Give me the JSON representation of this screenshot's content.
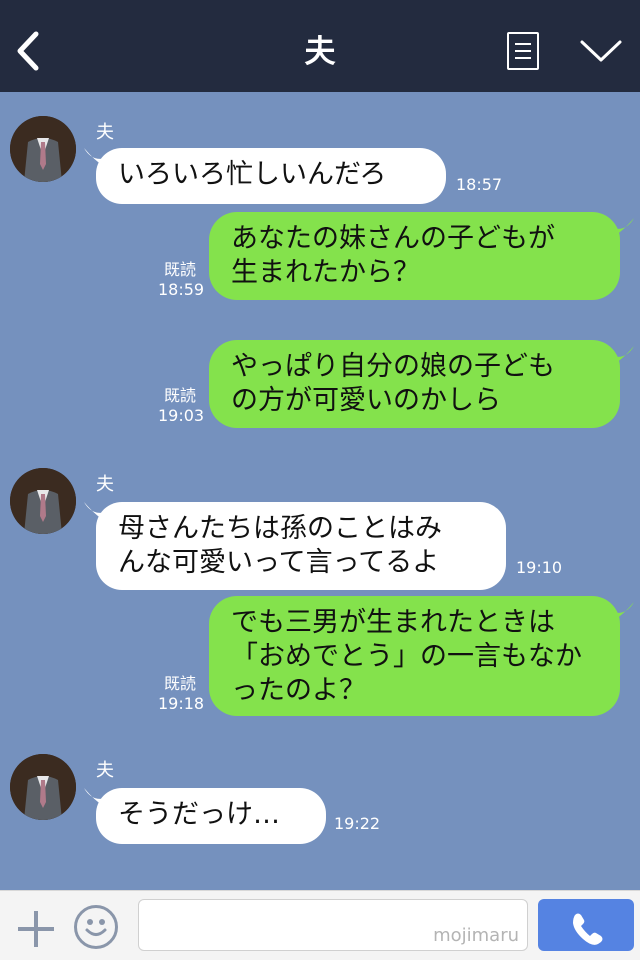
{
  "header": {
    "title": "夫",
    "icons": {
      "back": "chevron-left-icon",
      "notes": "notes-icon",
      "menu": "chevron-down-icon"
    }
  },
  "messages": [
    {
      "from": "夫",
      "dir": "in",
      "text": [
        "いろいろ忙しいんだろ"
      ],
      "time": "18:57"
    },
    {
      "dir": "out",
      "text": [
        "あなたの妹さんの子どもが",
        "生まれたから？"
      ],
      "read": "既読",
      "time": "18:59"
    },
    {
      "dir": "out",
      "text": [
        "やっぱり自分の娘の子ども",
        "の方が可愛いのかしら"
      ],
      "read": "既読",
      "time": "19:03"
    },
    {
      "from": "夫",
      "dir": "in",
      "text": [
        "母さんたちは孫のことはみ",
        "んな可愛いって言ってるよ"
      ],
      "time": "19:10"
    },
    {
      "dir": "out",
      "text": [
        "でも三男が生まれたときは",
        "「おめでとう」の一言もなか",
        "ったのよ？"
      ],
      "read": "既読",
      "time": "19:18"
    },
    {
      "from": "夫",
      "dir": "in",
      "text": [
        "そうだっけ…"
      ],
      "time": "19:22"
    }
  ],
  "input": {
    "value": "",
    "watermark": "mojimaru",
    "icons": {
      "add": "plus-icon",
      "emoji": "smiley-icon",
      "call": "phone-icon"
    }
  },
  "colors": {
    "header": "#232b3f",
    "chat_bg": "#7591be",
    "out_bubble": "#84e24c",
    "in_bubble": "#ffffff",
    "call_button": "#5583e2"
  }
}
